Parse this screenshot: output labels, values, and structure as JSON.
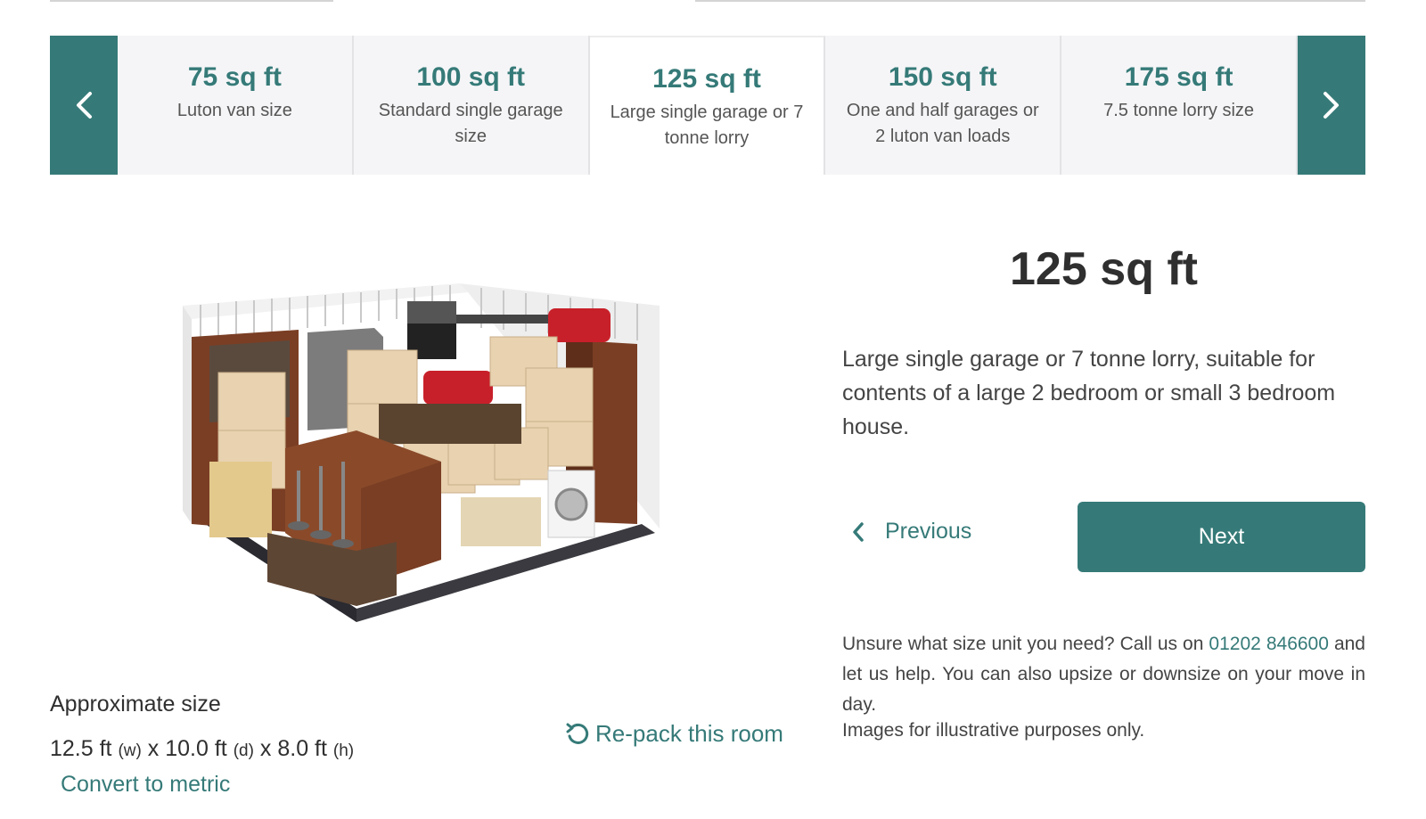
{
  "sizes": [
    {
      "size": "75 sq ft",
      "desc": "Luton van size"
    },
    {
      "size": "100 sq ft",
      "desc": "Standard single garage size"
    },
    {
      "size": "125 sq ft",
      "desc": "Large single garage or 7 tonne lorry"
    },
    {
      "size": "150 sq ft",
      "desc": "One and half garages or 2 luton van loads"
    },
    {
      "size": "175 sq ft",
      "desc": "7.5 tonne lorry size"
    }
  ],
  "selected": {
    "title": "125 sq ft",
    "description": "Large single garage or 7 tonne lorry, suitable for contents of a large 2 bedroom or small 3 bedroom house."
  },
  "nav": {
    "previous": "Previous",
    "next": "Next"
  },
  "approx": {
    "label": "Approximate size",
    "w_value": "12.5 ft",
    "w_unit": "(w)",
    "d_value": "10.0 ft",
    "d_unit": "(d)",
    "h_value": "8.0 ft",
    "h_unit": "(h)",
    "convert": "Convert to metric"
  },
  "repack": "Re-pack this room",
  "help": {
    "pre": "Unsure what size unit you need? Call us on",
    "phone": "01202 846600",
    "post": "and let us help. You can also upsize or downsize on your move in day.",
    "note": "Images for illustrative purposes only."
  },
  "colors": {
    "accent": "#357a78",
    "card_bg": "#f5f5f7"
  }
}
